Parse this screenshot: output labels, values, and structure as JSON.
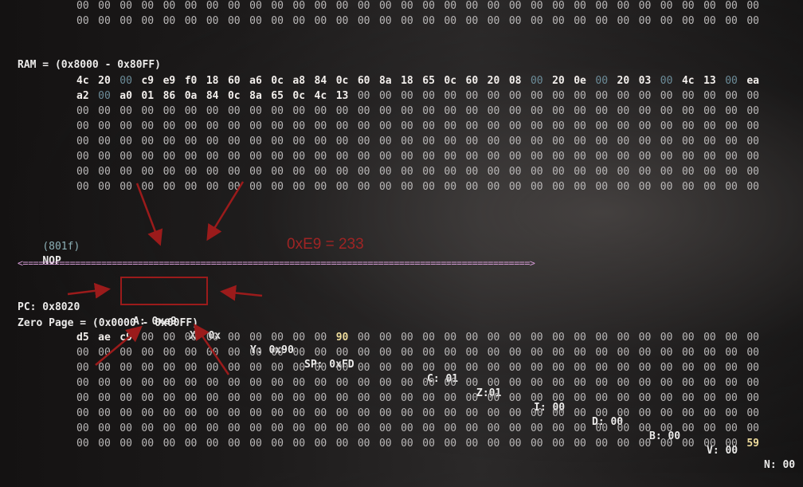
{
  "memory_top": {
    "rows": [
      [
        "00",
        "00",
        "00",
        "00",
        "00",
        "00",
        "00",
        "00",
        "00",
        "00",
        "00",
        "00",
        "00",
        "00",
        "00",
        "00",
        "00",
        "00",
        "00",
        "00",
        "00",
        "00",
        "00",
        "00",
        "00",
        "00",
        "00",
        "00",
        "00",
        "00",
        "00",
        "00"
      ],
      [
        "00",
        "00",
        "00",
        "00",
        "00",
        "00",
        "00",
        "00",
        "00",
        "00",
        "00",
        "00",
        "00",
        "00",
        "00",
        "00",
        "00",
        "00",
        "00",
        "00",
        "00",
        "00",
        "00",
        "00",
        "00",
        "00",
        "00",
        "00",
        "00",
        "00",
        "00",
        "00"
      ]
    ]
  },
  "ram": {
    "title": "RAM = (0x8000 - 0x80FF)",
    "rows": [
      [
        "4c",
        "20",
        "00",
        "c9",
        "e9",
        "f0",
        "18",
        "60",
        "a6",
        "0c",
        "a8",
        "84",
        "0c",
        "60",
        "8a",
        "18",
        "65",
        "0c",
        "60",
        "20",
        "08",
        "00",
        "20",
        "0e",
        "00",
        "20",
        "03",
        "00",
        "4c",
        "13",
        "00",
        "ea"
      ],
      [
        "a2",
        "00",
        "a0",
        "01",
        "86",
        "0a",
        "84",
        "0c",
        "8a",
        "65",
        "0c",
        "4c",
        "13",
        "00",
        "00",
        "00",
        "00",
        "00",
        "00",
        "00",
        "00",
        "00",
        "00",
        "00",
        "00",
        "00",
        "00",
        "00",
        "00",
        "00",
        "00",
        "00"
      ],
      [
        "00",
        "00",
        "00",
        "00",
        "00",
        "00",
        "00",
        "00",
        "00",
        "00",
        "00",
        "00",
        "00",
        "00",
        "00",
        "00",
        "00",
        "00",
        "00",
        "00",
        "00",
        "00",
        "00",
        "00",
        "00",
        "00",
        "00",
        "00",
        "00",
        "00",
        "00",
        "00"
      ],
      [
        "00",
        "00",
        "00",
        "00",
        "00",
        "00",
        "00",
        "00",
        "00",
        "00",
        "00",
        "00",
        "00",
        "00",
        "00",
        "00",
        "00",
        "00",
        "00",
        "00",
        "00",
        "00",
        "00",
        "00",
        "00",
        "00",
        "00",
        "00",
        "00",
        "00",
        "00",
        "00"
      ],
      [
        "00",
        "00",
        "00",
        "00",
        "00",
        "00",
        "00",
        "00",
        "00",
        "00",
        "00",
        "00",
        "00",
        "00",
        "00",
        "00",
        "00",
        "00",
        "00",
        "00",
        "00",
        "00",
        "00",
        "00",
        "00",
        "00",
        "00",
        "00",
        "00",
        "00",
        "00",
        "00"
      ],
      [
        "00",
        "00",
        "00",
        "00",
        "00",
        "00",
        "00",
        "00",
        "00",
        "00",
        "00",
        "00",
        "00",
        "00",
        "00",
        "00",
        "00",
        "00",
        "00",
        "00",
        "00",
        "00",
        "00",
        "00",
        "00",
        "00",
        "00",
        "00",
        "00",
        "00",
        "00",
        "00"
      ],
      [
        "00",
        "00",
        "00",
        "00",
        "00",
        "00",
        "00",
        "00",
        "00",
        "00",
        "00",
        "00",
        "00",
        "00",
        "00",
        "00",
        "00",
        "00",
        "00",
        "00",
        "00",
        "00",
        "00",
        "00",
        "00",
        "00",
        "00",
        "00",
        "00",
        "00",
        "00",
        "00"
      ],
      [
        "00",
        "00",
        "00",
        "00",
        "00",
        "00",
        "00",
        "00",
        "00",
        "00",
        "00",
        "00",
        "00",
        "00",
        "00",
        "00",
        "00",
        "00",
        "00",
        "00",
        "00",
        "00",
        "00",
        "00",
        "00",
        "00",
        "00",
        "00",
        "00",
        "00",
        "00",
        "00"
      ]
    ]
  },
  "instruction": {
    "address": "(801f)",
    "mnemonic": "NOP"
  },
  "separator": "<=================================================================================================>",
  "registers": {
    "pc": "PC: 0x8020",
    "a": "A: 0xe9",
    "x": "X: 0x",
    "y": "Y: 0x90",
    "sp": "SP: 0xFD",
    "flag_c": "C: 01",
    "flag_z": "Z:01",
    "flag_i": "I: 00",
    "flag_d": "D: 00",
    "flag_b": "B: 00",
    "flag_v": "V: 00",
    "flag_n": "N: 00"
  },
  "zero_page": {
    "title": "Zero Page = (0x0000 - 0x00FF)",
    "rows": [
      [
        "d5",
        "ae",
        "c9",
        "00",
        "00",
        "00",
        "00",
        "00",
        "00",
        "00",
        "00",
        "00",
        "90",
        "00",
        "00",
        "00",
        "00",
        "00",
        "00",
        "00",
        "00",
        "00",
        "00",
        "00",
        "00",
        "00",
        "00",
        "00",
        "00",
        "00",
        "00",
        "00"
      ],
      [
        "00",
        "00",
        "00",
        "00",
        "00",
        "00",
        "00",
        "00",
        "00",
        "00",
        "00",
        "00",
        "00",
        "00",
        "00",
        "00",
        "00",
        "00",
        "00",
        "00",
        "00",
        "00",
        "00",
        "00",
        "00",
        "00",
        "00",
        "00",
        "00",
        "00",
        "00",
        "00"
      ],
      [
        "00",
        "00",
        "00",
        "00",
        "00",
        "00",
        "00",
        "00",
        "00",
        "00",
        "00",
        "00",
        "00",
        "00",
        "00",
        "00",
        "00",
        "00",
        "00",
        "00",
        "00",
        "00",
        "00",
        "00",
        "00",
        "00",
        "00",
        "00",
        "00",
        "00",
        "00",
        "00"
      ],
      [
        "00",
        "00",
        "00",
        "00",
        "00",
        "00",
        "00",
        "00",
        "00",
        "00",
        "00",
        "00",
        "00",
        "00",
        "00",
        "00",
        "00",
        "00",
        "00",
        "00",
        "00",
        "00",
        "00",
        "00",
        "00",
        "00",
        "00",
        "00",
        "00",
        "00",
        "00",
        "00"
      ],
      [
        "00",
        "00",
        "00",
        "00",
        "00",
        "00",
        "00",
        "00",
        "00",
        "00",
        "00",
        "00",
        "00",
        "00",
        "00",
        "00",
        "00",
        "00",
        "00",
        "00",
        "00",
        "00",
        "00",
        "00",
        "00",
        "00",
        "00",
        "00",
        "00",
        "00",
        "00",
        "00"
      ],
      [
        "00",
        "00",
        "00",
        "00",
        "00",
        "00",
        "00",
        "00",
        "00",
        "00",
        "00",
        "00",
        "00",
        "00",
        "00",
        "00",
        "00",
        "00",
        "00",
        "00",
        "00",
        "00",
        "00",
        "00",
        "00",
        "00",
        "00",
        "00",
        "00",
        "00",
        "00",
        "00"
      ],
      [
        "00",
        "00",
        "00",
        "00",
        "00",
        "00",
        "00",
        "00",
        "00",
        "00",
        "00",
        "00",
        "00",
        "00",
        "00",
        "00",
        "00",
        "00",
        "00",
        "00",
        "00",
        "00",
        "00",
        "00",
        "00",
        "00",
        "00",
        "00",
        "00",
        "00",
        "00",
        "00"
      ],
      [
        "00",
        "00",
        "00",
        "00",
        "00",
        "00",
        "00",
        "00",
        "00",
        "00",
        "00",
        "00",
        "00",
        "00",
        "00",
        "00",
        "00",
        "00",
        "00",
        "00",
        "00",
        "00",
        "00",
        "00",
        "00",
        "00",
        "00",
        "00",
        "00",
        "00",
        "00",
        "59"
      ]
    ]
  },
  "annotation": {
    "text": "0xE9 = 233",
    "color": "#9b1b1b"
  }
}
